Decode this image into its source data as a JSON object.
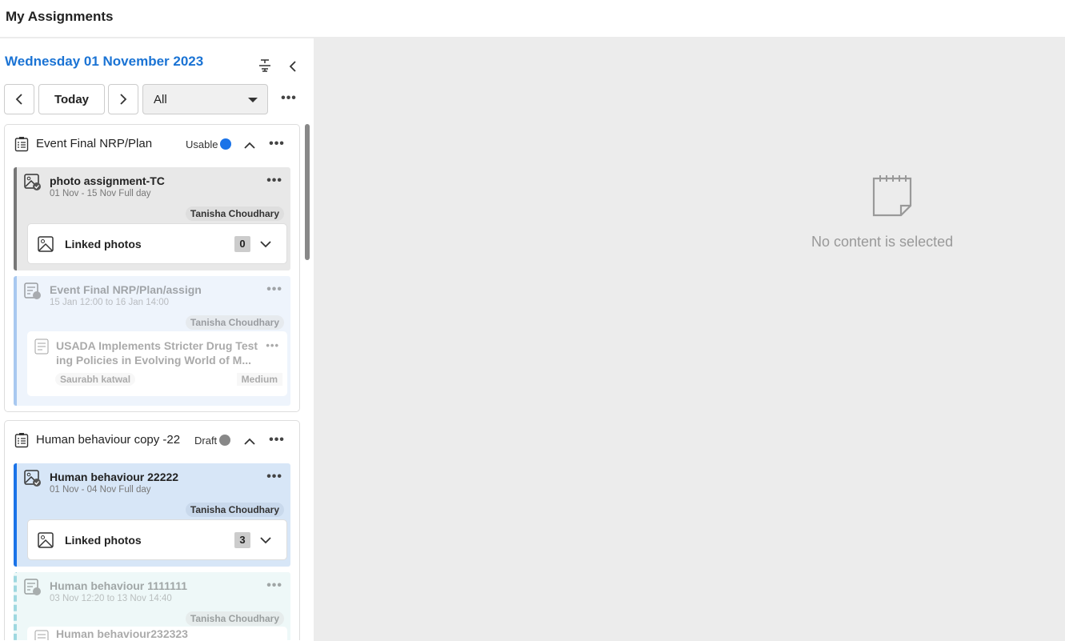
{
  "header": {
    "title": "My Assignments"
  },
  "panel": {
    "date": "Wednesday 01 November 2023",
    "today": "Today",
    "filter": "All"
  },
  "groups": [
    {
      "title": "Event Final NRP/Plan",
      "status": "Usable",
      "status_color": "#1a73e8",
      "items": [
        {
          "title": "photo assignment-TC",
          "dates": "01 Nov - 15 Nov Full day",
          "assignee": "Tanisha Choudhary",
          "linked_label": "Linked photos",
          "linked_count": "0"
        },
        {
          "title": "Event Final NRP/Plan/assign",
          "dates": "15 Jan 12:00 to 16 Jan 14:00",
          "assignee": "Tanisha Choudhary",
          "story_title": "USADA Implements Stricter Drug Test ing Policies in Evolving World of M...",
          "story_author": "Saurabh katwal",
          "story_priority": "Medium"
        }
      ]
    },
    {
      "title": "Human behaviour copy -22",
      "status": "Draft",
      "status_color": "#888888",
      "items": [
        {
          "title": "Human behaviour 22222",
          "dates": "01 Nov - 04 Nov Full day",
          "assignee": "Tanisha Choudhary",
          "linked_label": "Linked photos",
          "linked_count": "3"
        },
        {
          "title": "Human behaviour 1111111",
          "dates": "03 Nov 12:20 to 13 Nov 14:40",
          "assignee": "Tanisha Choudhary",
          "story_title": "Human behaviour232323"
        }
      ]
    }
  ],
  "main": {
    "empty_text": "No content is selected"
  }
}
